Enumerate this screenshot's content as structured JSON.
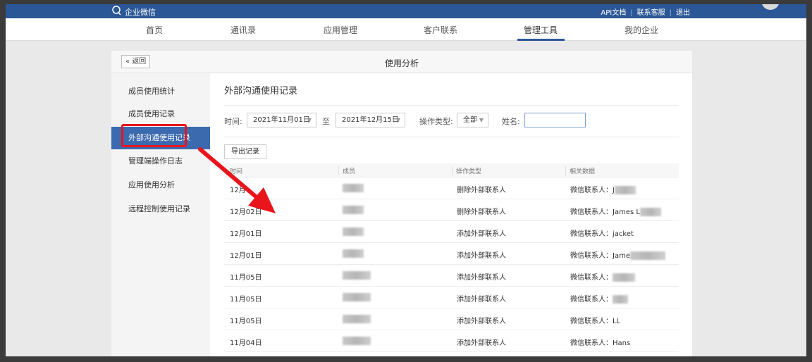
{
  "topbar": {
    "logo_text": "企业微信",
    "links": [
      "API文档",
      "联系客服",
      "退出"
    ],
    "separator": "|"
  },
  "nav": {
    "items": [
      {
        "label": "首页"
      },
      {
        "label": "通讯录"
      },
      {
        "label": "应用管理"
      },
      {
        "label": "客户联系"
      },
      {
        "label": "管理工具"
      },
      {
        "label": "我的企业"
      }
    ],
    "active_index": 4
  },
  "panel": {
    "back_label": "« 返回",
    "title": "使用分析"
  },
  "sidebar": {
    "items": [
      {
        "label": "成员使用统计"
      },
      {
        "label": "成员使用记录"
      },
      {
        "label": "外部沟通使用记录"
      },
      {
        "label": "管理端操作日志"
      },
      {
        "label": "应用使用分析"
      },
      {
        "label": "远程控制使用记录"
      }
    ],
    "active_index": 2
  },
  "content": {
    "section_title": "外部沟通使用记录",
    "filters": {
      "time_label": "时间:",
      "start_date": "2021年11月01日",
      "to_label": "至",
      "end_date": "2021年12月15日",
      "op_type_label": "操作类型:",
      "op_type_value": "全部",
      "name_label": "姓名:",
      "name_value": ""
    },
    "export_label": "导出记录",
    "table": {
      "headers": [
        "时间",
        "成员",
        "操作类型",
        "相关数据"
      ],
      "rows": [
        {
          "time": "12月",
          "op": "删除外部联系人",
          "data": "微信联系人：J"
        },
        {
          "time": "12月02日",
          "op": "删除外部联系人",
          "data": "微信联系人：James L"
        },
        {
          "time": "12月01日",
          "op": "添加外部联系人",
          "data": "微信联系人：jacket"
        },
        {
          "time": "12月01日",
          "op": "添加外部联系人",
          "data": "微信联系人：Jame"
        },
        {
          "time": "11月05日",
          "op": "添加外部联系人",
          "data": "微信联系人："
        },
        {
          "time": "11月05日",
          "op": "添加外部联系人",
          "data": "微信联系人："
        },
        {
          "time": "11月05日",
          "op": "添加外部联系人",
          "data": "微信联系人：LL"
        },
        {
          "time": "11月04日",
          "op": "添加外部联系人",
          "data": "微信联系人：Hans"
        }
      ]
    }
  },
  "colors": {
    "brand": "#2b5797",
    "sidebar_active": "#3c6aaf",
    "annotation": "#e8151c"
  }
}
